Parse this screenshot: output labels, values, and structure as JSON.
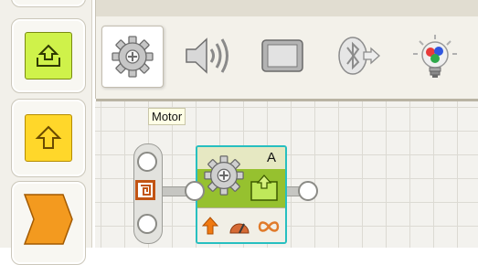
{
  "canvas": {
    "tooltip": "Motor",
    "motor_block": {
      "port": "A"
    }
  },
  "toolbar": {
    "buttons": [
      "motor-gear-icon",
      "speaker-icon",
      "display-icon",
      "bluetooth-icon",
      "light-bulb-icon"
    ],
    "selected": "motor-gear-icon"
  },
  "palette": {
    "tiles": [
      "lime-block-tile",
      "yellow-block-tile",
      "orange-block-tile"
    ]
  },
  "colors": {
    "block_green": "#96c12f",
    "lime": "#c9f53a",
    "yellow": "#ffd72a",
    "orange": "#f39a1f",
    "selection": "#27bfc0",
    "sequence_orange": "#c25414"
  }
}
